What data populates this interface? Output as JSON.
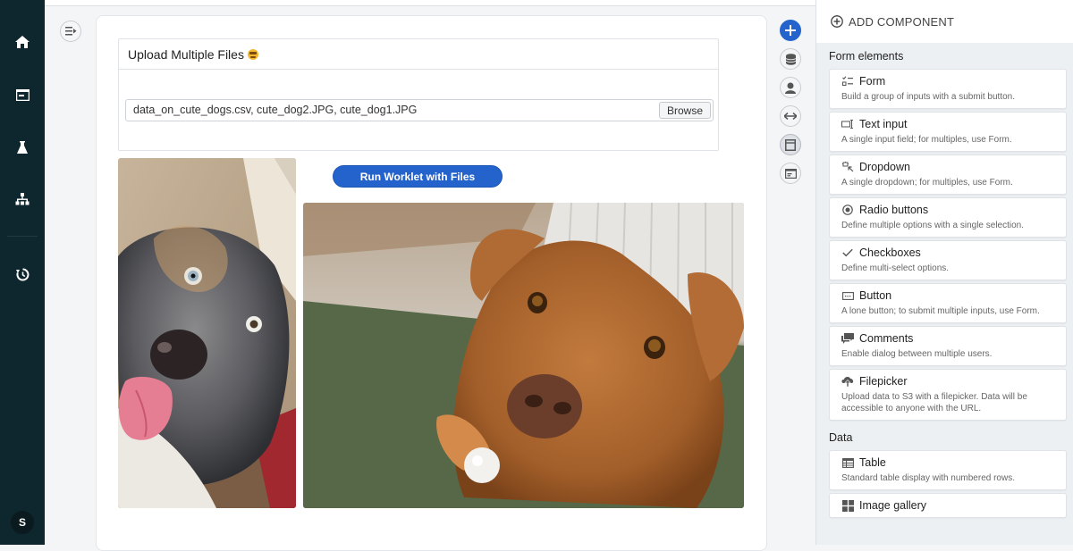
{
  "nav": {
    "items": [
      {
        "name": "home",
        "icon": "home-icon"
      },
      {
        "name": "apps",
        "icon": "window-icon"
      },
      {
        "name": "experiments",
        "icon": "flask-icon"
      },
      {
        "name": "hierarchy",
        "icon": "sitemap-icon"
      },
      {
        "name": "history",
        "icon": "history-icon"
      }
    ],
    "avatar_initial": "S"
  },
  "canvas": {
    "upload": {
      "title": "Upload Multiple Files",
      "emoji": "sunglasses-face-emoji",
      "file_value": "data_on_cute_dogs.csv, cute_dog2.JPG, cute_dog1.JPG",
      "browse_label": "Browse"
    },
    "run_button_label": "Run Worklet with Files",
    "images": [
      {
        "name": "cute_dog2",
        "description": "Australian shepherd puppy with tongue out"
      },
      {
        "name": "cute_dog1",
        "description": "Brown dog on grass with ball"
      }
    ]
  },
  "tools": [
    {
      "name": "add",
      "icon": "plus-icon",
      "state": "primary"
    },
    {
      "name": "data",
      "icon": "database-icon",
      "state": "normal"
    },
    {
      "name": "user",
      "icon": "user-icon",
      "state": "normal"
    },
    {
      "name": "width",
      "icon": "arrows-horizontal-icon",
      "state": "normal"
    },
    {
      "name": "layout",
      "icon": "layout-icon",
      "state": "active"
    },
    {
      "name": "preview",
      "icon": "browser-window-icon",
      "state": "normal"
    }
  ],
  "panel": {
    "header": "ADD COMPONENT",
    "sections": [
      {
        "title": "Form elements",
        "items": [
          {
            "label": "Form",
            "desc": "Build a group of inputs with a submit button.",
            "icon": "form-icon"
          },
          {
            "label": "Text input",
            "desc": "A single input field; for multiples, use Form.",
            "icon": "text-input-icon"
          },
          {
            "label": "Dropdown",
            "desc": "A single dropdown; for multiples, use Form.",
            "icon": "dropdown-icon"
          },
          {
            "label": "Radio buttons",
            "desc": "Define multiple options with a single selection.",
            "icon": "radio-icon"
          },
          {
            "label": "Checkboxes",
            "desc": "Define multi-select options.",
            "icon": "check-icon"
          },
          {
            "label": "Button",
            "desc": "A lone button; to submit multiple inputs, use Form.",
            "icon": "button-icon"
          },
          {
            "label": "Comments",
            "desc": "Enable dialog between multiple users.",
            "icon": "comments-icon"
          },
          {
            "label": "Filepicker",
            "desc": "Upload data to S3 with a filepicker. Data will be accessible to anyone with the URL.",
            "icon": "upload-cloud-icon"
          }
        ]
      },
      {
        "title": "Data",
        "items": [
          {
            "label": "Table",
            "desc": "Standard table display with numbered rows.",
            "icon": "table-icon"
          },
          {
            "label": "Image gallery",
            "desc": "",
            "icon": "grid-icon"
          }
        ]
      }
    ]
  }
}
